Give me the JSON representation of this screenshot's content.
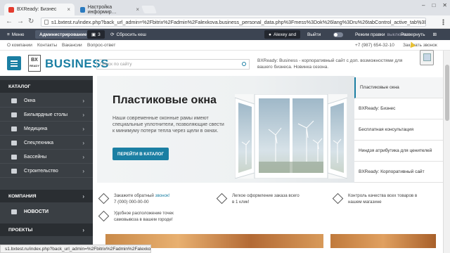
{
  "browser": {
    "tabs": [
      {
        "label": "BXReady: Бизнес",
        "active": true
      },
      {
        "label": "Настройка информир…",
        "active": false
      }
    ],
    "url": "s1.bxtest.ru/index.php?back_url_admin=%2Fbitrix%2Fadmin%2Falexkova.business_personal_data.php%3Fmess%3Dok%26lang%3Dru%26tabControl_active_tab%3D",
    "status_url": "s1.bxtest.ru/index.php?back_url_admin=%2Fbitrix%2Fadmin%2Falexkova.busi..."
  },
  "admin_panel": {
    "menu": "Меню",
    "admin": "Администрирование",
    "count": "3",
    "clear_cache": "Сбросить кеш",
    "user": "Alexey and",
    "logout": "Выйти",
    "edit_mode": "Режим правки",
    "edit_state": "выключен",
    "expand": "Развернуть"
  },
  "top_links": [
    "О компании",
    "Контакты",
    "Вакансии",
    "Вопрос-ответ"
  ],
  "header": {
    "logo_box": "BX",
    "logo_box_sub": "READY",
    "logo_text": "BUSINESS",
    "search_placeholder": "Поиск по сайту",
    "tagline": "BXReady: Business - корпоративный сайт с доп. возможностями для вашего бизнеса. Новинка сезона.",
    "phone": "+7 (987) 654-32-10",
    "callback": "Заказать звонок"
  },
  "sidebar": {
    "catalog": "КАТАЛОГ",
    "items": [
      "Окна",
      "Бильярдные столы",
      "Медицина",
      "Спецтехника",
      "Бассейны",
      "Строительство"
    ],
    "company": "КОМПАНИЯ",
    "news": "НОВОСТИ",
    "projects": "ПРОЕКТЫ"
  },
  "banner": {
    "title": "Пластиковые окна",
    "text": "Наши современные оконные рамы имеют специальные уплотнители, позволяющие свести к минимуму потери тепла через щели в окнах.",
    "button": "ПЕРЕЙТИ В КАТАЛОГ"
  },
  "right_list": [
    "Пластиковые окна",
    "BXReady: Бизнес",
    "Бесплатная консультация",
    "Ниндзя атрибутика для ценителей",
    "BXReady: Корпоративный сайт"
  ],
  "features": {
    "callback_pre": "Закажите обратный",
    "callback_link": "звонок!",
    "callback_phone": "7 (000) 000-00-00",
    "order": "Легкое оформление заказа всего в 1 клик!",
    "quality": "Контроль качества всех товаров в нашем магазине",
    "location": "Удобное расположение точек самовывоза в вашем городе!"
  },
  "colors": {
    "accent": "#1b7fa3",
    "sidebar": "#3a3f44",
    "admin": "#3c4452"
  }
}
